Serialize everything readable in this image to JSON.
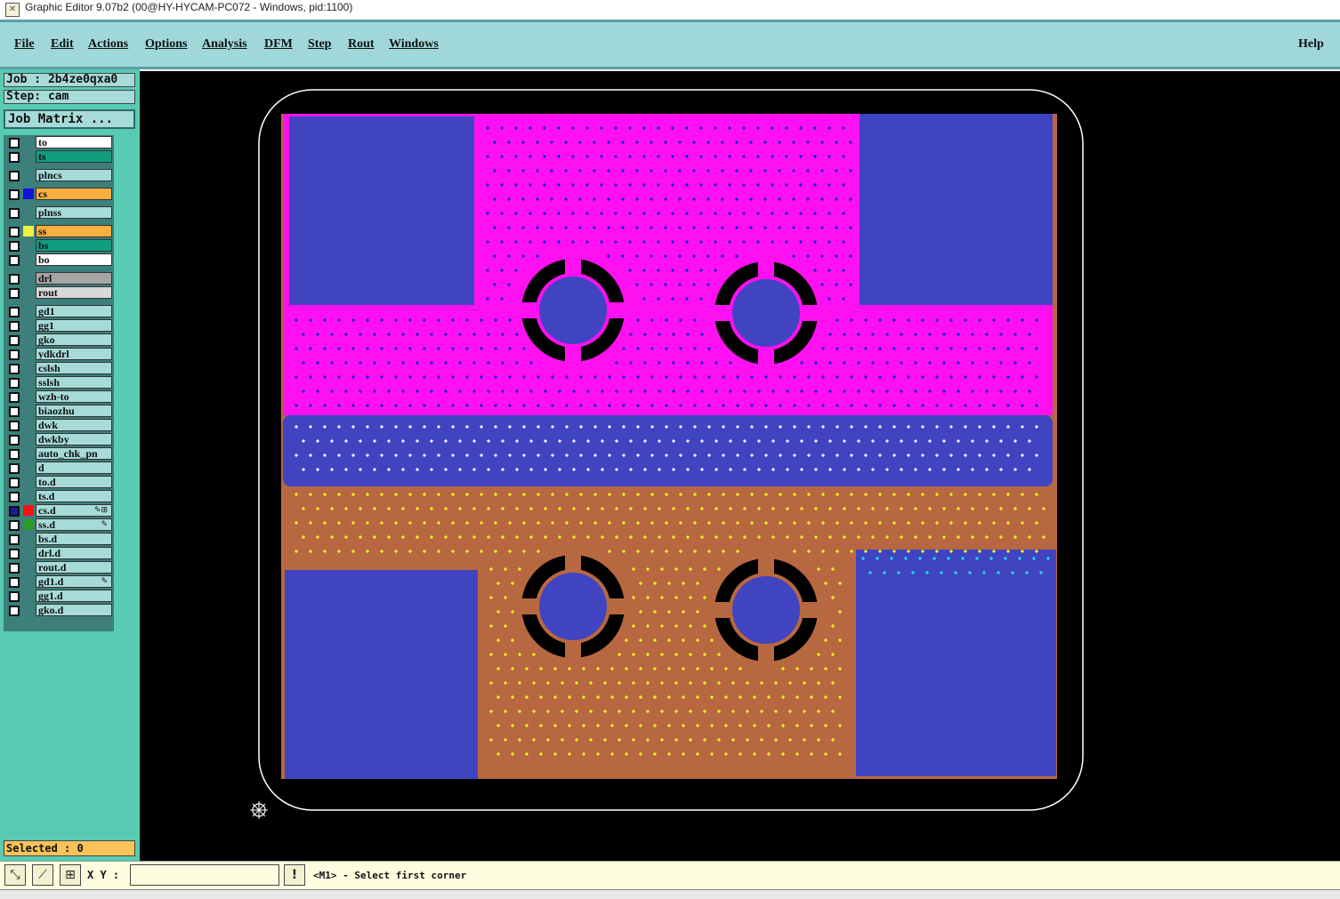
{
  "window": {
    "title": "Graphic Editor 9.07b2 (00@HY-HYCAM-PC072 - Windows, pid:1100)",
    "icon": "app-icon"
  },
  "menu": {
    "items": [
      "File",
      "Edit",
      "Actions",
      "Options",
      "Analysis",
      "DFM",
      "Step",
      "Rout",
      "Windows"
    ],
    "help": "Help"
  },
  "job": {
    "label": "Job : 2b4ze0qxa0",
    "step": "Step: cam",
    "matrix_button": "Job Matrix ..."
  },
  "layers": [
    {
      "name": "to",
      "color": "#ffffff",
      "swatch": ""
    },
    {
      "name": "ts",
      "color": "#109e80",
      "swatch": ""
    },
    {
      "name": "plncs",
      "color": "#a6dbd9",
      "swatch": ""
    },
    {
      "name": "cs",
      "color": "#f9b040",
      "swatch": "#1414d8"
    },
    {
      "name": "plnss",
      "color": "#a6dbd9",
      "swatch": ""
    },
    {
      "name": "ss",
      "color": "#f9b040",
      "swatch": "#f0f040"
    },
    {
      "name": "bs",
      "color": "#109e80",
      "swatch": ""
    },
    {
      "name": "bo",
      "color": "#ffffff",
      "swatch": ""
    },
    {
      "name": "drl",
      "color": "#a6a6a6",
      "swatch": ""
    },
    {
      "name": "rout",
      "color": "#d8d8d8",
      "swatch": ""
    },
    {
      "name": "gd1",
      "color": "#a6dbd9",
      "swatch": ""
    },
    {
      "name": "gg1",
      "color": "#a6dbd9",
      "swatch": ""
    },
    {
      "name": "gko",
      "color": "#a6dbd9",
      "swatch": ""
    },
    {
      "name": "ydkdrl",
      "color": "#a6dbd9",
      "swatch": ""
    },
    {
      "name": "cslsh",
      "color": "#a6dbd9",
      "swatch": ""
    },
    {
      "name": "sslsh",
      "color": "#a6dbd9",
      "swatch": ""
    },
    {
      "name": "wzh-to",
      "color": "#a6dbd9",
      "swatch": ""
    },
    {
      "name": "biaozhu",
      "color": "#a6dbd9",
      "swatch": ""
    },
    {
      "name": "dwk",
      "color": "#a6dbd9",
      "swatch": ""
    },
    {
      "name": "dwkby",
      "color": "#a6dbd9",
      "swatch": ""
    },
    {
      "name": "auto_chk_pn",
      "color": "#a6dbd9",
      "swatch": ""
    },
    {
      "name": "d",
      "color": "#a6dbd9",
      "swatch": ""
    },
    {
      "name": "to.d",
      "color": "#a6dbd9",
      "swatch": ""
    },
    {
      "name": "ts.d",
      "color": "#a6dbd9",
      "swatch": ""
    },
    {
      "name": "cs.d",
      "color": "#a6dbd9",
      "swatch": "#ff1010",
      "checked": true,
      "marks": "✎⊞"
    },
    {
      "name": "ss.d",
      "color": "#a6dbd9",
      "swatch": "#2a9a2a",
      "marks": "✎"
    },
    {
      "name": "bs.d",
      "color": "#a6dbd9",
      "swatch": ""
    },
    {
      "name": "drl.d",
      "color": "#a6dbd9",
      "swatch": ""
    },
    {
      "name": "rout.d",
      "color": "#a6dbd9",
      "swatch": ""
    },
    {
      "name": "gd1.d",
      "color": "#a6dbd9",
      "swatch": "",
      "marks": "✎"
    },
    {
      "name": "gg1.d",
      "color": "#a6dbd9",
      "swatch": ""
    },
    {
      "name": "gko.d",
      "color": "#a6dbd9",
      "swatch": ""
    }
  ],
  "selected": "Selected : 0",
  "status": {
    "xy_label": "X Y :",
    "xy_value": "",
    "prompt": "<M1> - Select first corner",
    "tools": [
      "zoom-box-icon",
      "measure-icon",
      "snap-grid-icon"
    ],
    "warning_icon": "exclamation-icon"
  },
  "canvas": {
    "background": "#000000",
    "colors": {
      "magenta": "#ff10f0",
      "blue": "#4044c0",
      "copper": "#b86840",
      "dot_blue": "#2020d0",
      "dot_white": "#f0e8ff",
      "dot_cyan": "#20d8e8",
      "dot_yellow": "#f0f020",
      "outline": "#ffffff"
    },
    "origin_icon": "origin-crosshair-icon"
  }
}
